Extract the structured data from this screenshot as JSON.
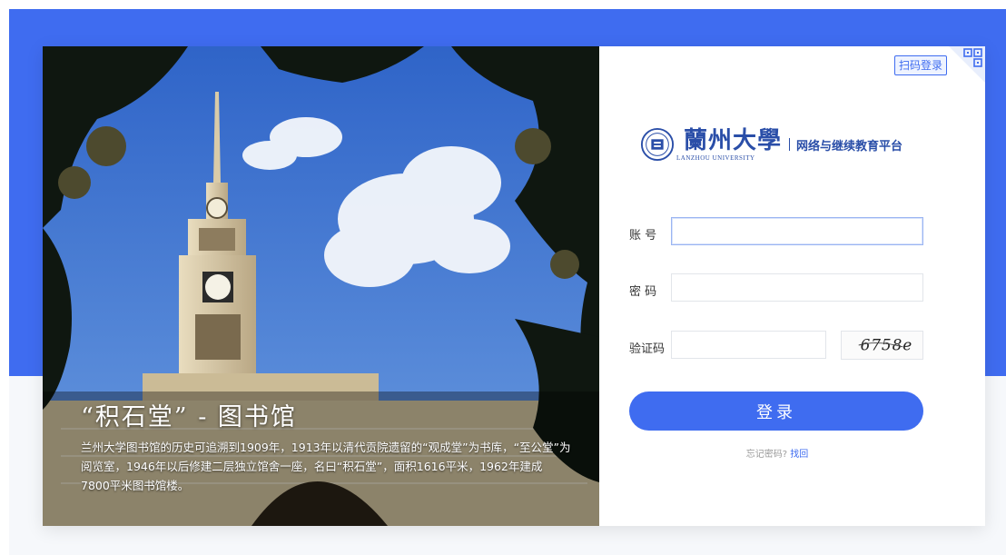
{
  "hero": {
    "title": "“积石堂” - 图书馆",
    "description": "兰州大学图书馆的历史可追溯到1909年，1913年以清代贡院遗留的“观成堂”为书库，“至公堂”为阅览室，1946年以后修建二层独立馆舍一座，名曰“积石堂”，面积1616平米，1962年建成7800平米图书馆楼。"
  },
  "header": {
    "scan_login_label": "扫码登录",
    "qr_icon": "qr-code-icon"
  },
  "logo": {
    "name_cn": "蘭州大學",
    "name_en": "LANZHOU UNIVERSITY",
    "platform": "网络与继续教育平台"
  },
  "form": {
    "account_label": "账 号",
    "account_value": "",
    "password_label": "密 码",
    "password_value": "",
    "captcha_label": "验证码",
    "captcha_value": "",
    "captcha_text": "6758e",
    "login_label": "登录",
    "forgot_text": "忘记密码?",
    "forgot_link": "找回"
  },
  "colors": {
    "brand": "#3f6cf0",
    "logo": "#2a4ea8"
  }
}
